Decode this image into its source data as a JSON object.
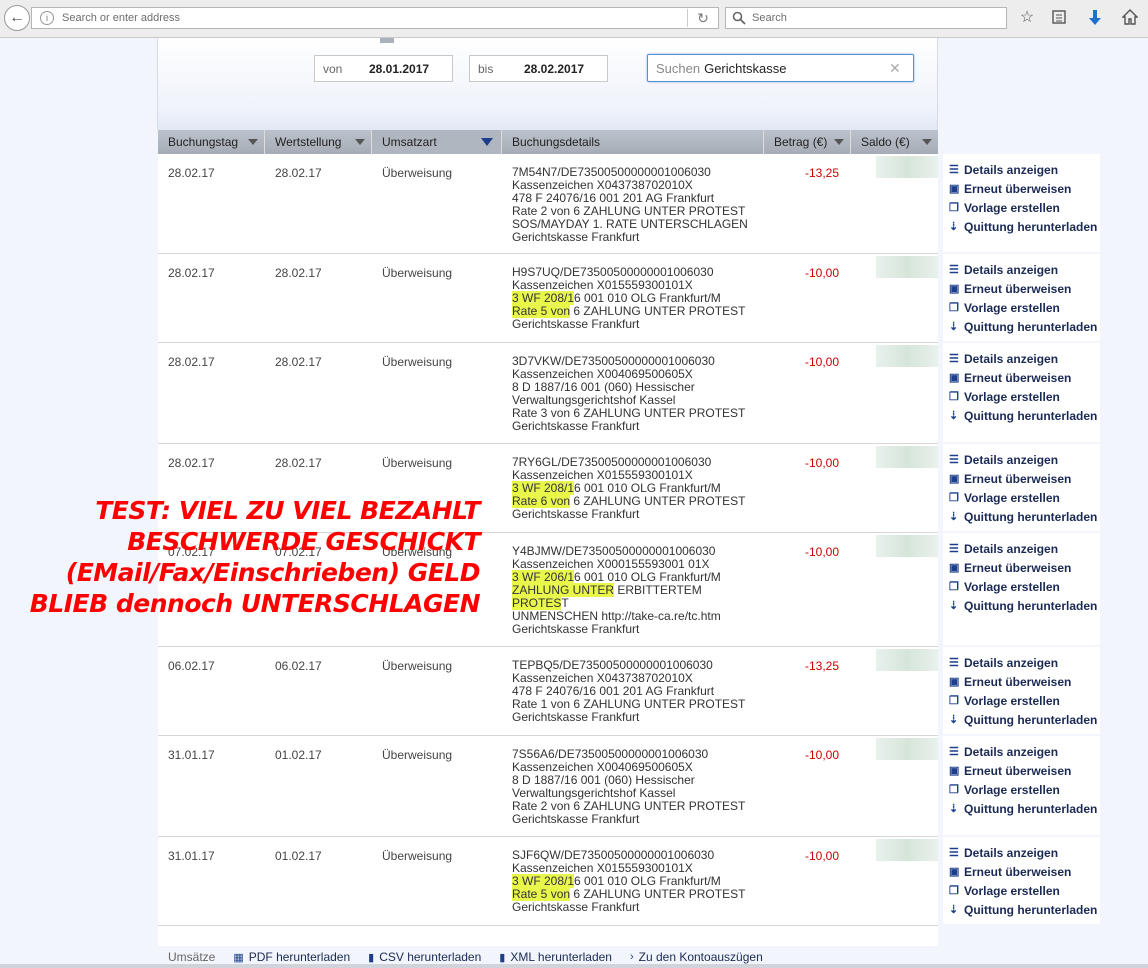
{
  "browser": {
    "address_placeholder": "Search or enter address",
    "search_placeholder": "Search"
  },
  "filter": {
    "from_label": "von",
    "from_value": "28.01.2017",
    "to_label": "bis",
    "to_value": "28.02.2017",
    "search_prefix": "Suchen",
    "search_value": "Gerichtskasse"
  },
  "columns": [
    "Buchungstag",
    "Wertstellung",
    "Umsatzart",
    "Buchungsdetails",
    "Betrag (€)",
    "Saldo (€)"
  ],
  "actions": [
    "Details anzeigen",
    "Erneut überweisen",
    "Vorlage erstellen",
    "Quittung herunterladen"
  ],
  "rows": [
    {
      "buchungstag": "28.02.17",
      "wertstellung": "28.02.17",
      "umsatzart": "Überweisung",
      "details": [
        "7M54N7/DE73500500000001006030",
        "Kassenzeichen X043738702010X",
        "478 F 24076/16 001 201 AG Frankfurt",
        "Rate 2 von 6 ZAHLUNG UNTER PROTEST",
        "SOS/MAYDAY 1. RATE UNTERSCHLAGEN",
        "Gerichtskasse Frankfurt"
      ],
      "betrag": "-13,25"
    },
    {
      "buchungstag": "28.02.17",
      "wertstellung": "28.02.17",
      "umsatzart": "Überweisung",
      "details": [
        "H9S7UQ/DE73500500000001006030",
        "Kassenzeichen X015559300101X",
        "3 WF 208/16 001 010 OLG Frankfurt/M",
        "Rate 5 von 6 ZAHLUNG UNTER PROTEST",
        "Gerichtskasse Frankfurt"
      ],
      "betrag": "-10,00"
    },
    {
      "buchungstag": "28.02.17",
      "wertstellung": "28.02.17",
      "umsatzart": "Überweisung",
      "details": [
        "3D7VKW/DE73500500000001006030",
        "Kassenzeichen X004069500605X",
        "8 D 1887/16 001 (060) Hessischer",
        "Verwaltungsgerichtshof Kassel",
        "Rate 3 von 6 ZAHLUNG UNTER PROTEST",
        "Gerichtskasse Frankfurt"
      ],
      "betrag": "-10,00"
    },
    {
      "buchungstag": "28.02.17",
      "wertstellung": "28.02.17",
      "umsatzart": "Überweisung",
      "details": [
        "7RY6GL/DE73500500000001006030",
        "Kassenzeichen X015559300101X",
        "3 WF 208/16 001 010 OLG Frankfurt/M",
        "Rate 6 von 6 ZAHLUNG UNTER PROTEST",
        "Gerichtskasse Frankfurt"
      ],
      "betrag": "-10,00"
    },
    {
      "buchungstag": "07.02.17",
      "wertstellung": "07.02.17",
      "umsatzart": "Überweisung",
      "details": [
        "Y4BJMW/DE73500500000001006030",
        "Kassenzeichen X000155593001 01X",
        "3 WF 206/16 001 010 OLG Frankfurt/M",
        "ZAHLUNG UNTER ERBITTERTEM",
        "PROTEST",
        "UNMENSCHEN http://take-ca.re/tc.htm",
        "Gerichtskasse Frankfurt"
      ],
      "betrag": "-10,00"
    },
    {
      "buchungstag": "06.02.17",
      "wertstellung": "06.02.17",
      "umsatzart": "Überweisung",
      "details": [
        "TEPBQ5/DE73500500000001006030",
        "Kassenzeichen X043738702010X",
        "478 F 24076/16 001 201 AG Frankfurt",
        "Rate 1 von 6 ZAHLUNG UNTER PROTEST",
        "Gerichtskasse Frankfurt"
      ],
      "betrag": "-13,25"
    },
    {
      "buchungstag": "31.01.17",
      "wertstellung": "01.02.17",
      "umsatzart": "Überweisung",
      "details": [
        "7S56A6/DE73500500000001006030",
        "Kassenzeichen X004069500605X",
        "8 D 1887/16 001 (060) Hessischer",
        "Verwaltungsgerichtshof Kassel",
        "Rate 2 von 6 ZAHLUNG UNTER PROTEST",
        "Gerichtskasse Frankfurt"
      ],
      "betrag": "-10,00"
    },
    {
      "buchungstag": "31.01.17",
      "wertstellung": "01.02.17",
      "umsatzart": "Überweisung",
      "details": [
        "SJF6QW/DE73500500000001006030",
        "Kassenzeichen X015559300101X",
        "3 WF 208/16 001 010 OLG Frankfurt/M",
        "Rate 5 von 6 ZAHLUNG UNTER PROTEST",
        "Gerichtskasse Frankfurt"
      ],
      "betrag": "-10,00"
    }
  ],
  "overlay_lines": [
    "TEST: VIEL ZU VIEL BEZAHLT",
    "BESCHWERDE GESCHICKT",
    "(EMail/Fax/Einschrieben) GELD",
    "BLIEB dennoch UNTERSCHLAGEN"
  ],
  "footer": {
    "label": "Umsätze",
    "links": [
      "PDF herunterladen",
      "CSV herunterladen",
      "XML herunterladen",
      "Zu den Kontoauszügen"
    ]
  },
  "colors": {
    "amount": "#cc0000",
    "overlay": "#ff0000",
    "highlight": "#e9f74b",
    "action_icon": "#1d3e8c"
  }
}
